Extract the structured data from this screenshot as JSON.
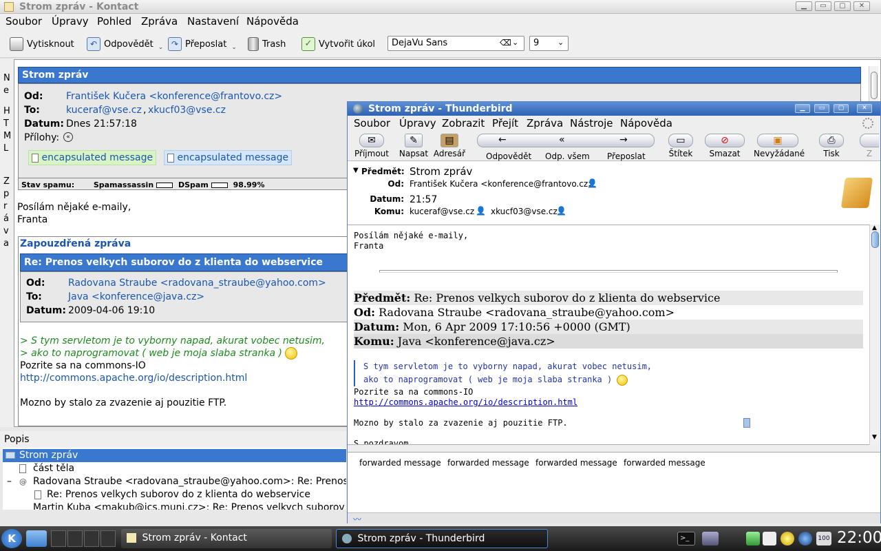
{
  "kontact": {
    "title": "Strom zpráv - Kontact",
    "menu": [
      "Soubor",
      "Úpravy",
      "Pohled",
      "Zpráva",
      "Nastavení",
      "Nápověda"
    ],
    "toolbar": {
      "print": "Vytisknout",
      "reply": "Odpovědět",
      "forward": "Přeposlat",
      "trash": "Trash",
      "create_task": "Vytvořit úkol",
      "font": "DejaVu Sans",
      "font_size": "9"
    },
    "left_strip_top": [
      "N",
      "e",
      "",
      "H",
      "T",
      "M",
      "L"
    ],
    "left_strip_bottom": [
      "Z",
      "p",
      "r",
      "á",
      "v",
      "a"
    ],
    "reader": {
      "header_title": "Strom zpráv",
      "from_label": "Od:",
      "from_value": "František Kučera <konference@frantovo.cz>",
      "to_label": "To:",
      "to_value_1": "kuceraf@vse.cz",
      "to_sep": ",",
      "to_value_2": "xkucf03@vse.cz",
      "date_label": "Datum:",
      "date_value": "Dnes 21:57:18",
      "attachments_label": "Přílohy:",
      "attachment_1": "encapsulated message",
      "attachment_2": "encapsulated message",
      "spam_label": "Stav spamu:",
      "spamassassin": "Spamassassin",
      "dspam": "DSpam",
      "spam_percent": "98.99%",
      "body_line1": "Posílám nějaké e-maily,",
      "body_line2": "Franta",
      "enc_title": "Zapouzdřená zpráva",
      "enc_subject": "Re: Prenos velkych suborov do z klienta do webservice",
      "enc_from_label": "Od:",
      "enc_from_value": "Radovana Straube <radovana_straube@yahoo.com>",
      "enc_to_label": "To:",
      "enc_to_value": "Java <konference@java.cz>",
      "enc_date_label": "Datum:",
      "enc_date_value": "2009-04-06 19:10",
      "quote1": "> S tym servletom je to vyborny napad, akurat vobec netusim,",
      "quote2": "> ako to naprogramovat ( web je moja slaba stranka )",
      "line_pozrite": "Pozrite sa na commons-IO",
      "link": "http://commons.apache.org/io/description.html",
      "line_mozno": "Mozno by stalo za zvazenie aj pouzitie FTP."
    },
    "popis_label": "Popis",
    "tree": [
      "Strom zpráv",
      "část těla",
      "Radovana Straube <radovana_straube@yahoo.com>: Re: Prenos velkych suborov do z klienta do webservice",
      "Re: Prenos velkych suborov do z klienta do webservice",
      "Martin Kuba <makub@ics.muni.cz>: Re: Prenos velkych suborov do z klienta do webservice"
    ]
  },
  "thunderbird": {
    "title": "Strom zpráv - Thunderbird",
    "menu": [
      "Soubor",
      "Úpravy",
      "Zobrazit",
      "Přejít",
      "Zpráva",
      "Nástroje",
      "Nápověda"
    ],
    "toolbar": {
      "get": "Příjmout",
      "write": "Napsat",
      "address": "Adresář",
      "reply": "Odpovědět",
      "reply_all": "Odp. všem",
      "forward": "Přeposlat",
      "tag": "Štítek",
      "delete": "Smazat",
      "junk": "Nevyžádané",
      "print": "Tisk",
      "z": "Z"
    },
    "headers": {
      "subject_label": "Předmět:",
      "subject": "Strom zpráv",
      "from_label": "Od:",
      "from": "František Kučera <konference@frantovo.cz>",
      "date_label": "Datum:",
      "date": "21:57",
      "to_label": "Komu:",
      "to_1": "kuceraf@vse.cz",
      "to_2": "xkucf03@vse.cz"
    },
    "body": {
      "line1": "Posílám nějaké e-maily,",
      "line2": "Franta",
      "fwd_subject_label": "Předmět:",
      "fwd_subject": "Re: Prenos velkych suborov do z klienta do webservice",
      "fwd_from_label": "Od:",
      "fwd_from": "Radovana Straube <radovana_straube@yahoo.com>",
      "fwd_date_label": "Datum:",
      "fwd_date": "Mon, 6 Apr 2009 17:10:56 +0000 (GMT)",
      "fwd_to_label": "Komu:",
      "fwd_to": "Java <konference@java.cz>",
      "quote1": "S tym servletom je to vyborny napad, akurat vobec netusim,",
      "quote2": "ako to naprogramovat ( web je moja slaba stranka )",
      "pozrite": "Pozrite sa na commons-IO",
      "link": "http://commons.apache.org/io/description.html",
      "mozno": "Mozno by stalo za zvazenie aj pouzitie FTP.",
      "greeting": "S pozdravom"
    },
    "attachments": [
      "forwarded message",
      "forwarded message",
      "forwarded message",
      "forwarded message"
    ]
  },
  "taskbar": {
    "task_kontact": "Strom zpráv - Kontact",
    "task_thunderbird": "Strom zpráv - Thunderbird",
    "battery": "100",
    "clock": "22:00"
  }
}
